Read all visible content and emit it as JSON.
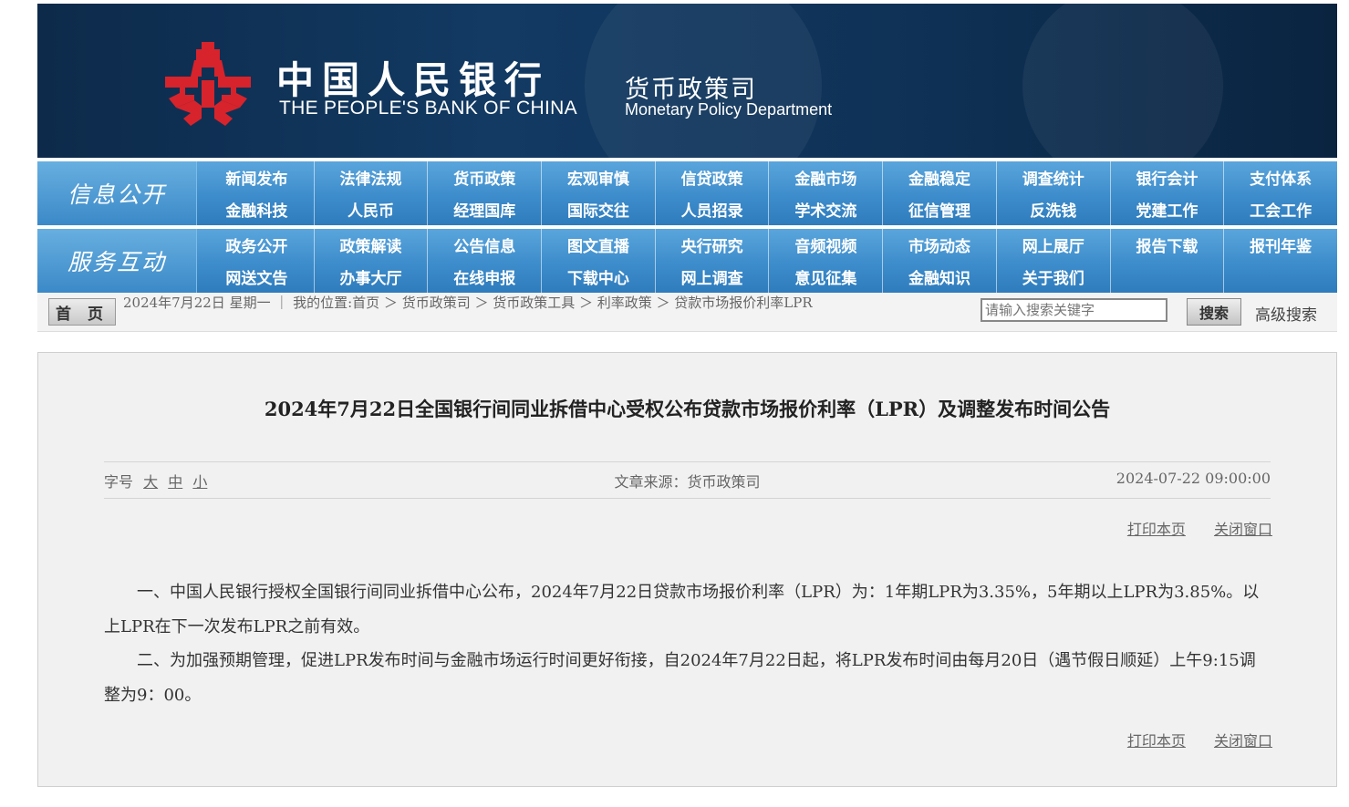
{
  "banner": {
    "bank_cn": "中国人民银行",
    "bank_en": "THE PEOPLE'S BANK OF CHINA",
    "dept_cn": "货币政策司",
    "dept_en": "Monetary Policy Department",
    "logo_color": "#d7232b"
  },
  "nav": [
    {
      "section": "信息公开",
      "items": [
        "新闻发布",
        "法律法规",
        "货币政策",
        "宏观审慎",
        "信贷政策",
        "金融市场",
        "金融稳定",
        "调查统计",
        "银行会计",
        "支付体系",
        "金融科技",
        "人民币",
        "经理国库",
        "国际交往",
        "人员招录",
        "学术交流",
        "征信管理",
        "反洗钱",
        "党建工作",
        "工会工作"
      ]
    },
    {
      "section": "服务互动",
      "items": [
        "政务公开",
        "政策解读",
        "公告信息",
        "图文直播",
        "央行研究",
        "音频视频",
        "市场动态",
        "网上展厅",
        "报告下载",
        "报刊年鉴",
        "网送文告",
        "办事大厅",
        "在线申报",
        "下载中心",
        "网上调查",
        "意见征集",
        "金融知识",
        "关于我们",
        "",
        ""
      ]
    }
  ],
  "crumbbar": {
    "home_label": "首 页",
    "date_text": "2024年7月22日 星期一 ｜ 我的位置:首页 ＞ 货币政策司 ＞ 货币政策工具 ＞ 利率政策 ＞ 贷款市场报价利率LPR",
    "search_placeholder": "请输入搜索关键字",
    "search_button": "搜索",
    "advanced_search": "高级搜索"
  },
  "article": {
    "title": "2024年7月22日全国银行间同业拆借中心受权公布贷款市场报价利率（LPR）及调整发布时间公告",
    "font_size_label": "字号",
    "font_sizes": [
      "大",
      "中",
      "小"
    ],
    "source": "文章来源：货币政策司",
    "datetime": "2024-07-22  09:00:00",
    "print_label": "打印本页",
    "close_label": "关闭窗口",
    "paragraphs": [
      "一、中国人民银行授权全国银行间同业拆借中心公布，2024年7月22日贷款市场报价利率（LPR）为：1年期LPR为3.35%，5年期以上LPR为3.85%。以上LPR在下一次发布LPR之前有效。",
      "二、为加强预期管理，促进LPR发布时间与金融市场运行时间更好衔接，自2024年7月22日起，将LPR发布时间由每月20日（遇节假日顺延）上午9:15调整为9：00。"
    ]
  }
}
